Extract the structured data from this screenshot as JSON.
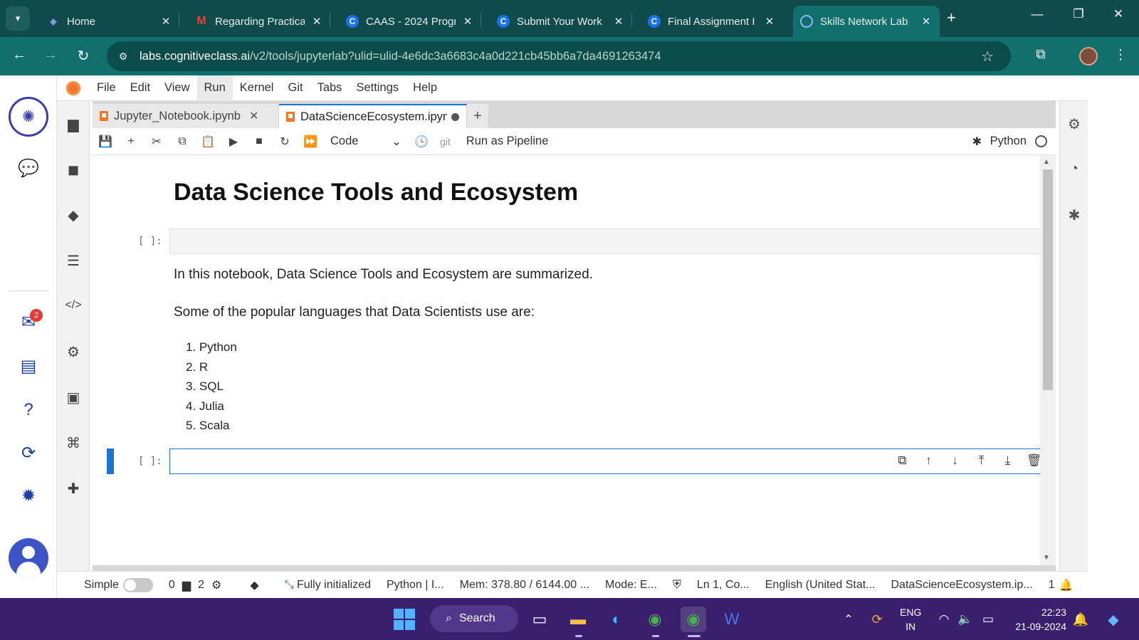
{
  "browser": {
    "tabs": [
      {
        "title": "Home",
        "favicon": "home-favicon"
      },
      {
        "title": "Regarding Practica",
        "favicon": "gmail-favicon"
      },
      {
        "title": "CAAS - 2024 Progr",
        "favicon": "coursera-favicon"
      },
      {
        "title": "Submit Your Work",
        "favicon": "coursera-favicon"
      },
      {
        "title": "Final Assignment I",
        "favicon": "coursera-favicon"
      },
      {
        "title": "Skills Network Lab",
        "favicon": "skills-network-favicon",
        "active": true
      }
    ],
    "url_host": "labs.cognitiveclass.ai",
    "url_path": "/v2/tools/jupyterlab?ulid=ulid-4e6dc3a6683c4a0d221cb45bb6a7da4691263474"
  },
  "rail": {
    "notification_count": "2"
  },
  "jupyter": {
    "menu": [
      "File",
      "Edit",
      "View",
      "Run",
      "Kernel",
      "Git",
      "Tabs",
      "Settings",
      "Help"
    ],
    "active_menu": "Run",
    "doc_tabs": [
      {
        "label": "Jupyter_Notebook.ipynb"
      },
      {
        "label": "DataScienceEcosystem.ipynb"
      }
    ],
    "toolbar": {
      "cell_type": "Code",
      "git_label": "git",
      "pipeline_label": "Run as Pipeline",
      "kernel_name": "Python"
    },
    "notebook": {
      "heading": "Data Science Tools and Ecosystem",
      "empty_prompt": "[ ]:",
      "intro": "In this notebook, Data Science Tools and Ecosystem are summarized.",
      "languages_intro": "Some of the popular languages that Data Scientists use are:",
      "languages": [
        "1. Python",
        "2. R",
        "3. SQL",
        "4. Julia",
        "5. Scala"
      ],
      "active_prompt": "[ ]:"
    },
    "status": {
      "mode_label": "Simple",
      "terminals": "0",
      "kernels": "2",
      "init_state": "Fully initialized",
      "kernel": "Python | I...",
      "memory": "Mem: 378.80 / 6144.00 ...",
      "mode": "Mode: E...",
      "cursor": "Ln 1, Co...",
      "language": "English (United Stat...",
      "filename": "DataScienceEcosystem.ip...",
      "notif_count": "1"
    }
  },
  "taskbar": {
    "search_label": "Search",
    "lang_line1": "ENG",
    "lang_line2": "IN",
    "time": "22:23",
    "date": "21-09-2024"
  }
}
